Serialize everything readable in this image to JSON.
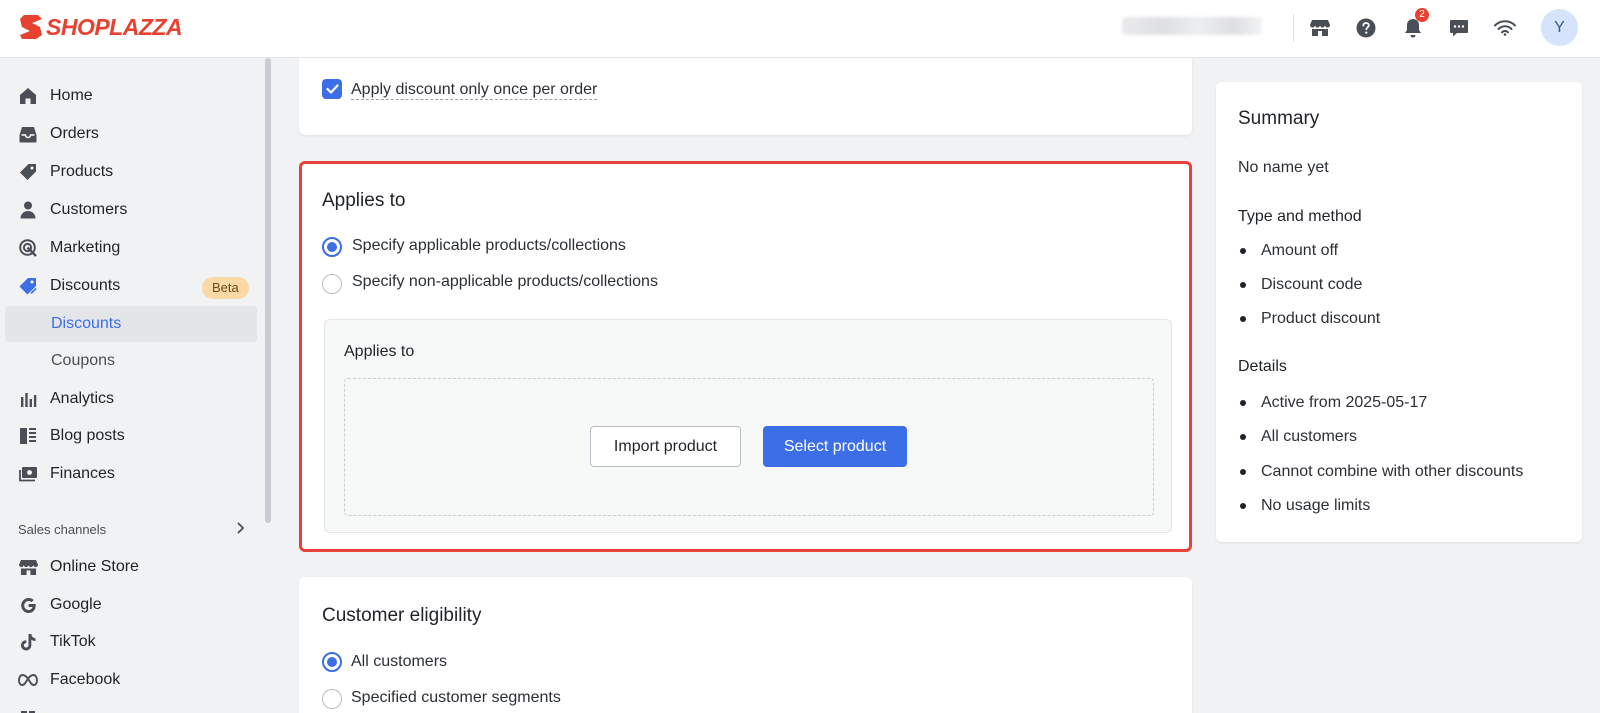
{
  "brand": {
    "name": "SHOPLAZZA",
    "color": "#e8412f"
  },
  "topbar": {
    "notifications_count": "2",
    "avatar_initial": "Y",
    "icons": [
      "store-icon",
      "help-icon",
      "bell-icon",
      "chat-icon",
      "wifi-icon"
    ]
  },
  "sidebar": {
    "items": [
      {
        "label": "Home",
        "icon": "home-icon"
      },
      {
        "label": "Orders",
        "icon": "inbox-icon"
      },
      {
        "label": "Products",
        "icon": "tag-icon"
      },
      {
        "label": "Customers",
        "icon": "person-icon"
      },
      {
        "label": "Marketing",
        "icon": "target-icon"
      },
      {
        "label": "Discounts",
        "icon": "discount-tag-icon",
        "badge": "Beta"
      },
      {
        "label": "Discounts",
        "sub": true,
        "active": true
      },
      {
        "label": "Coupons",
        "sub": true
      },
      {
        "label": "Analytics",
        "icon": "bar-chart-icon"
      },
      {
        "label": "Blog posts",
        "icon": "blog-icon"
      },
      {
        "label": "Finances",
        "icon": "finance-icon"
      }
    ],
    "sales_channels_label": "Sales channels",
    "channels": [
      {
        "label": "Online Store",
        "icon": "store-icon"
      },
      {
        "label": "Google",
        "icon": "google-icon"
      },
      {
        "label": "TikTok",
        "icon": "tiktok-icon"
      },
      {
        "label": "Facebook",
        "icon": "meta-icon"
      }
    ]
  },
  "top_card": {
    "checkbox_label": "Apply discount only once per order",
    "checked": true
  },
  "applies_to": {
    "title": "Applies to",
    "options": [
      {
        "label": "Specify applicable products/collections",
        "selected": true
      },
      {
        "label": "Specify non-applicable products/collections",
        "selected": false
      }
    ],
    "inner_title": "Applies to",
    "import_button": "Import product",
    "select_button": "Select product"
  },
  "customer_eligibility": {
    "title": "Customer eligibility",
    "options": [
      {
        "label": "All customers",
        "selected": true
      },
      {
        "label": "Specified customer segments",
        "selected": false
      }
    ]
  },
  "summary": {
    "title": "Summary",
    "name": "No name yet",
    "type_heading": "Type and method",
    "type_items": [
      "Amount off",
      "Discount code",
      "Product discount"
    ],
    "details_heading": "Details",
    "details_items": [
      "Active from 2025-05-17",
      "All customers",
      "Cannot combine with other discounts",
      "No usage limits"
    ]
  },
  "colors": {
    "accent": "#3c6ee8",
    "highlight_border": "#e8413c",
    "badge_bg": "#fbd9a5"
  }
}
